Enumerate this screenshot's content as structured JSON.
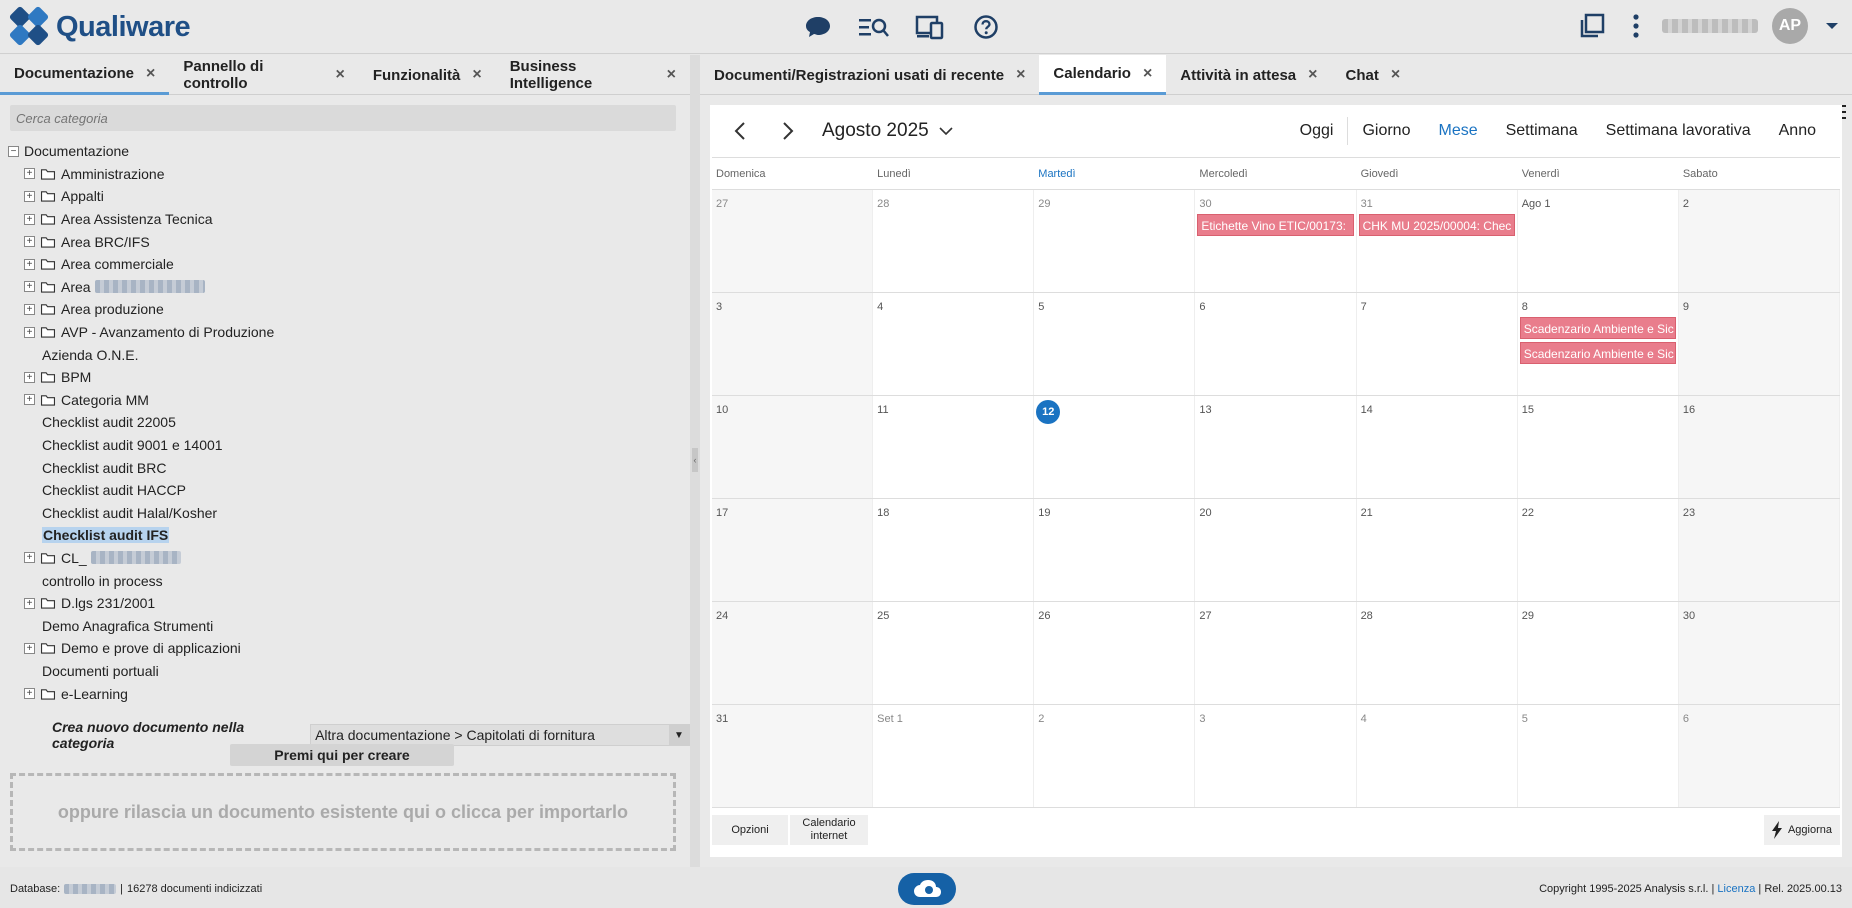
{
  "app": {
    "logo_text": "Qualiware",
    "user_initials": "AP"
  },
  "icons": {
    "chat": "chat-bubble-icon",
    "search": "search-list-icon",
    "devices": "devices-icon",
    "help": "help-icon",
    "windows": "windows-icon",
    "more": "more-vertical-icon",
    "dropdown": "chevron-down-icon"
  },
  "colors": {
    "brand": "#1f4f86",
    "accent": "#1a73c2",
    "event": "#e97d8c"
  },
  "left_tabs": [
    {
      "label": "Documentazione",
      "close": "×"
    },
    {
      "label": "Pannello di controllo",
      "close": "×"
    },
    {
      "label": "Funzionalità",
      "close": "×"
    },
    {
      "label": "Business Intelligence",
      "close": "×"
    }
  ],
  "search": {
    "placeholder": "Cerca categoria"
  },
  "tree": {
    "root": "Documentazione",
    "items": [
      {
        "label": "Amministrazione"
      },
      {
        "label": "Appalti"
      },
      {
        "label": "Area Assistenza Tecnica"
      },
      {
        "label": "Area BRC/IFS"
      },
      {
        "label": "Area commerciale"
      },
      {
        "label": "Area"
      },
      {
        "label": "Area produzione"
      },
      {
        "label": "AVP - Avanzamento di Produzione"
      },
      {
        "label": "Azienda O.N.E."
      },
      {
        "label": "BPM"
      },
      {
        "label": "Categoria MM"
      },
      {
        "label": "Checklist audit 22005"
      },
      {
        "label": "Checklist audit 9001 e 14001"
      },
      {
        "label": "Checklist audit BRC"
      },
      {
        "label": "Checklist audit HACCP"
      },
      {
        "label": "Checklist audit Halal/Kosher"
      },
      {
        "label": "Checklist audit IFS"
      },
      {
        "label": "CL_"
      },
      {
        "label": "controllo in process"
      },
      {
        "label": "D.lgs 231/2001"
      },
      {
        "label": "Demo Anagrafica Strumenti"
      },
      {
        "label": "Demo e prove di applicazioni"
      },
      {
        "label": "Documenti portuali"
      },
      {
        "label": "e-Learning"
      }
    ]
  },
  "create": {
    "label": "Crea nuovo documento nella categoria",
    "selected": "Altra documentazione > Capitolati di fornitura",
    "button": "Premi qui per creare",
    "dropzone": "oppure rilascia un documento esistente qui o clicca per importarlo"
  },
  "right_tabs": [
    {
      "label": "Documenti/Registrazioni usati di recente",
      "close": "×"
    },
    {
      "label": "Calendario",
      "close": "×"
    },
    {
      "label": "Attività in attesa",
      "close": "×"
    },
    {
      "label": "Chat",
      "close": "×"
    }
  ],
  "calendar": {
    "title": "Agosto 2025",
    "views": [
      "Oggi",
      "Giorno",
      "Mese",
      "Settimana",
      "Settimana lavorativa",
      "Anno"
    ],
    "active_view": "Mese",
    "weekdays": [
      "Domenica",
      "Lunedì",
      "Martedì",
      "Mercoledì",
      "Giovedì",
      "Venerdì",
      "Sabato"
    ],
    "today_weekday": "Martedì",
    "weeks": [
      [
        "27",
        "28",
        "29",
        "30",
        "31",
        "Ago 1",
        "2"
      ],
      [
        "3",
        "4",
        "5",
        "6",
        "7",
        "8",
        "9"
      ],
      [
        "10",
        "11",
        "12",
        "13",
        "14",
        "15",
        "16"
      ],
      [
        "17",
        "18",
        "19",
        "20",
        "21",
        "22",
        "23"
      ],
      [
        "24",
        "25",
        "26",
        "27",
        "28",
        "29",
        "30"
      ],
      [
        "31",
        "Set 1",
        "2",
        "3",
        "4",
        "5",
        "6"
      ]
    ],
    "today": "12",
    "events": [
      {
        "week": 0,
        "day": 3,
        "slot": 0,
        "title": "Etichette Vino ETIC/00173:"
      },
      {
        "week": 0,
        "day": 4,
        "slot": 0,
        "title": "CHK MU 2025/00004: Chec"
      },
      {
        "week": 1,
        "day": 5,
        "slot": 0,
        "title": "Scadenzario Ambiente e Sic"
      },
      {
        "week": 1,
        "day": 5,
        "slot": 1,
        "title": "Scadenzario Ambiente e Sic"
      }
    ],
    "footer": {
      "options": "Opzioni",
      "internet_line1": "Calendario",
      "internet_line2": "internet",
      "refresh": "Aggiorna"
    }
  },
  "status": {
    "db_label": "Database:",
    "docs": "16278 documenti indicizzati",
    "copyright": "Copyright 1995-2025 Analysis s.r.l. |",
    "license": "Licenza",
    "release": "| Rel.  2025.00.13"
  }
}
